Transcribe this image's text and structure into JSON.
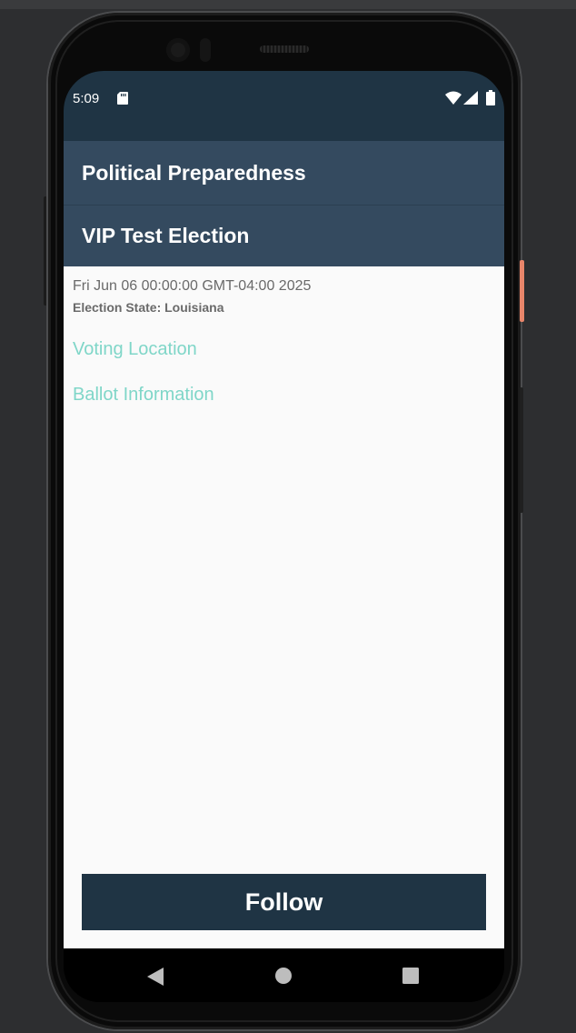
{
  "status_bar": {
    "time": "5:09",
    "icons": [
      "sd-card-icon",
      "wifi-icon",
      "signal-icon",
      "battery-icon"
    ]
  },
  "app_bar": {
    "title": "Political Preparedness"
  },
  "election": {
    "name": "VIP Test Election",
    "date": "Fri Jun 06 00:00:00 GMT-04:00 2025",
    "state_label": "Election State: Louisiana",
    "voting_location_link": "Voting Location",
    "ballot_info_link": "Ballot Information"
  },
  "actions": {
    "follow_label": "Follow"
  },
  "nav_bar": {
    "icons": [
      "back-icon",
      "home-icon",
      "recents-icon"
    ]
  },
  "colors": {
    "status_bar_bg": "#1f3444",
    "app_bar_bg": "#344a5f",
    "link": "#7fd6c8",
    "button_bg": "#1f3444",
    "content_bg": "#fafafa",
    "power_button_accent": "#e8856a"
  }
}
